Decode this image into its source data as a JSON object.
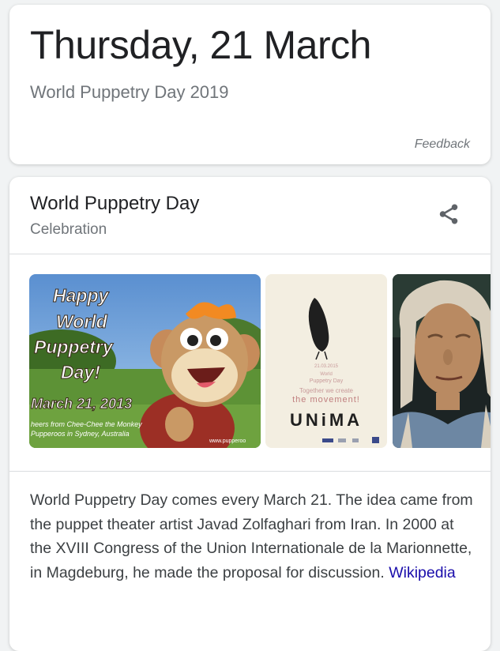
{
  "date_card": {
    "title": "Thursday, 21 March",
    "subtitle": "World Puppetry Day 2019",
    "feedback": "Feedback"
  },
  "knowledge_panel": {
    "title": "World Puppetry Day",
    "subtitle": "Celebration",
    "share_icon": "share-icon",
    "images": [
      {
        "caption_lines": [
          "Happy",
          "World",
          "Puppetry",
          "Day!"
        ],
        "date": "March 21, 2013",
        "credit_lines": [
          "heers from Chee-Chee the Monkey",
          "Pupperoos in Sydney, Australia"
        ],
        "url": "www.pupperoo"
      },
      {
        "date": "21.03.2015",
        "lines": [
          "World",
          "Puppetry Day",
          "Together we create",
          "the movement!"
        ],
        "logo": "UNiMA"
      },
      {}
    ],
    "description": "World Puppetry Day comes every March 21. The idea came from the puppet theater artist Javad Zolfaghari from Iran. In 2000 at the XVIII Congress of the Union Internationale de la Marionnette, in Magdeburg, he made the proposal for discussion.",
    "source_link": "Wikipedia"
  },
  "colors": {
    "background": "#f1f3f4",
    "title": "#202124",
    "secondary": "#70757a",
    "link": "#1a0dab"
  }
}
